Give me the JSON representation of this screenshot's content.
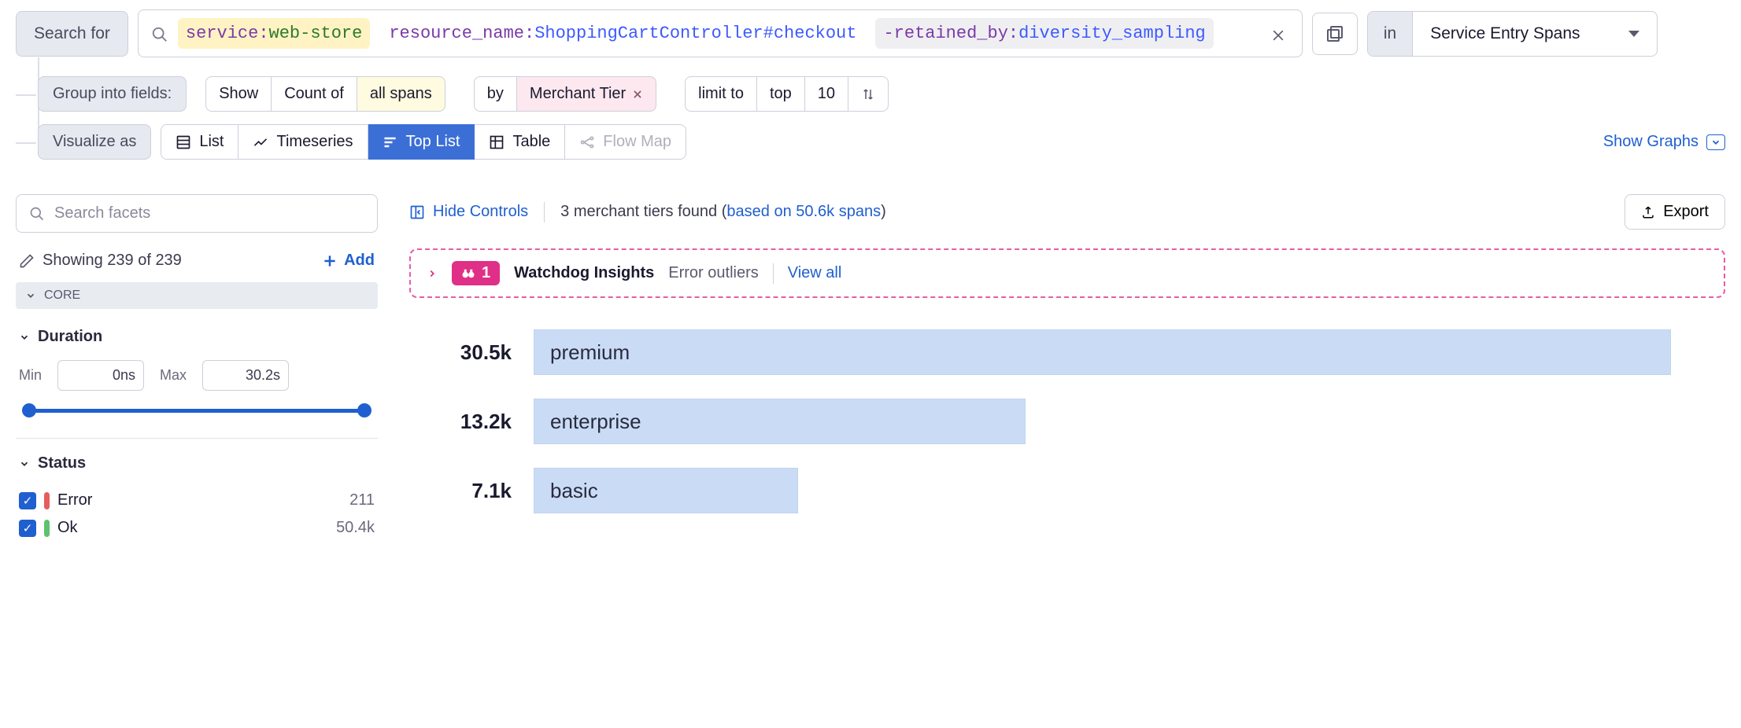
{
  "search": {
    "button_label": "Search for",
    "tokens": [
      {
        "key": "service",
        "value": "web-store",
        "style": "yellow",
        "value_color": "green"
      },
      {
        "key": "resource_name",
        "value": "ShoppingCartController#checkout",
        "style": "plain",
        "value_color": "blue"
      },
      {
        "key": "-retained_by",
        "value": "diversity_sampling",
        "style": "gray",
        "value_color": "blue"
      }
    ],
    "in_label": "in",
    "in_value": "Service Entry Spans"
  },
  "group": {
    "label": "Group into fields:",
    "show": "Show",
    "count_of": "Count of",
    "all_spans": "all spans",
    "by": "by",
    "dimension": "Merchant Tier",
    "limit_to": "limit to",
    "top": "top",
    "limit_value": "10"
  },
  "viz": {
    "label": "Visualize as",
    "list": "List",
    "timeseries": "Timeseries",
    "toplist": "Top List",
    "table": "Table",
    "flowmap": "Flow Map",
    "show_graphs": "Show Graphs"
  },
  "facets": {
    "search_placeholder": "Search facets",
    "showing": "Showing 239 of 239",
    "add": "Add",
    "core": "CORE",
    "duration": {
      "title": "Duration",
      "min_label": "Min",
      "min_value": "0ns",
      "max_label": "Max",
      "max_value": "30.2s"
    },
    "status": {
      "title": "Status",
      "items": [
        {
          "label": "Error",
          "count": "211",
          "color": "red"
        },
        {
          "label": "Ok",
          "count": "50.4k",
          "color": "green"
        }
      ]
    }
  },
  "content": {
    "hide_controls": "Hide Controls",
    "found_prefix": "3 merchant tiers found (",
    "found_link": "based on 50.6k spans",
    "found_suffix": ")",
    "export": "Export"
  },
  "watchdog": {
    "badge_count": "1",
    "title": "Watchdog Insights",
    "subtitle": "Error outliers",
    "view_all": "View all"
  },
  "chart_data": {
    "type": "bar",
    "orientation": "horizontal",
    "title": "",
    "xlabel": "count",
    "ylabel": "Merchant Tier",
    "categories": [
      "premium",
      "enterprise",
      "basic"
    ],
    "values": [
      30500,
      13200,
      7100
    ],
    "value_labels": [
      "30.5k",
      "13.2k",
      "7.1k"
    ],
    "xlim": [
      0,
      30500
    ]
  }
}
